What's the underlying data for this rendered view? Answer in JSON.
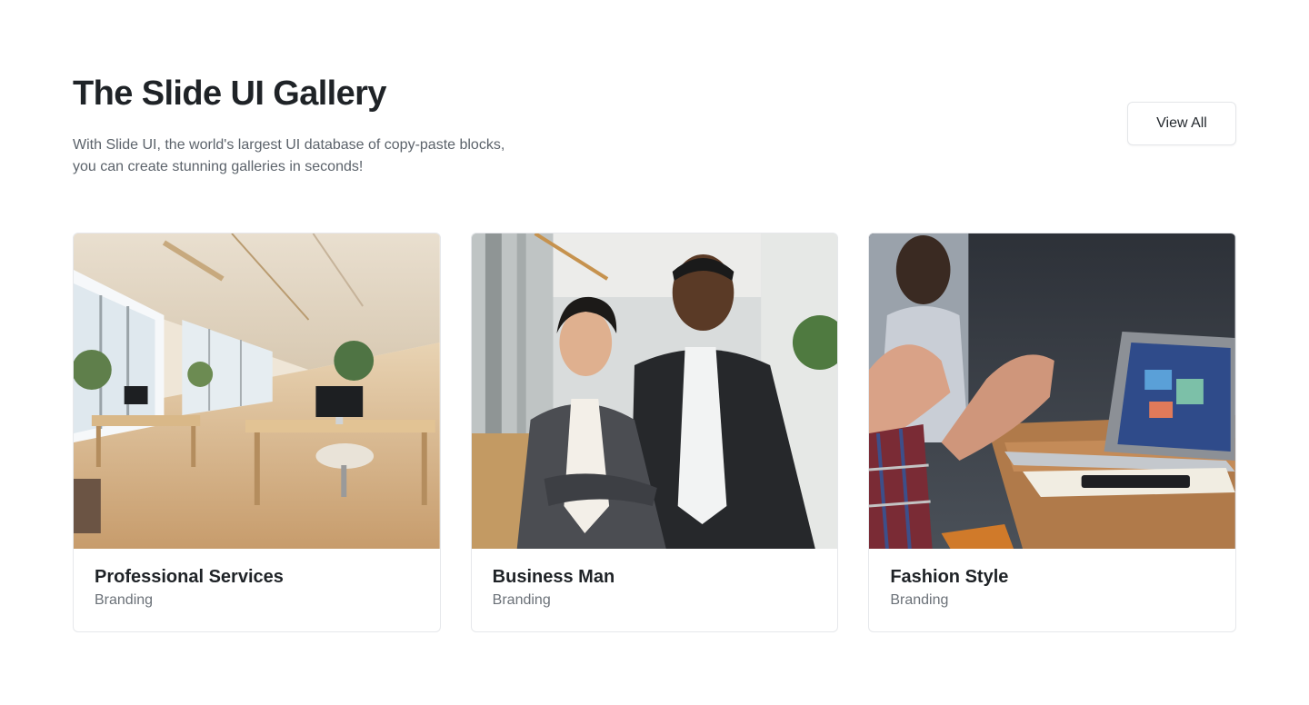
{
  "header": {
    "title": "The Slide UI Gallery",
    "subtitle": "With Slide UI, the world's largest UI database of copy-paste blocks, you can create stunning galleries in seconds!",
    "view_all_label": "View All"
  },
  "gallery": {
    "cards": [
      {
        "title": "Professional Services",
        "tag": "Branding",
        "image": "office-interior-photo"
      },
      {
        "title": "Business Man",
        "tag": "Branding",
        "image": "business-people-photo"
      },
      {
        "title": "Fashion Style",
        "tag": "Branding",
        "image": "meeting-laptop-photo"
      }
    ]
  }
}
